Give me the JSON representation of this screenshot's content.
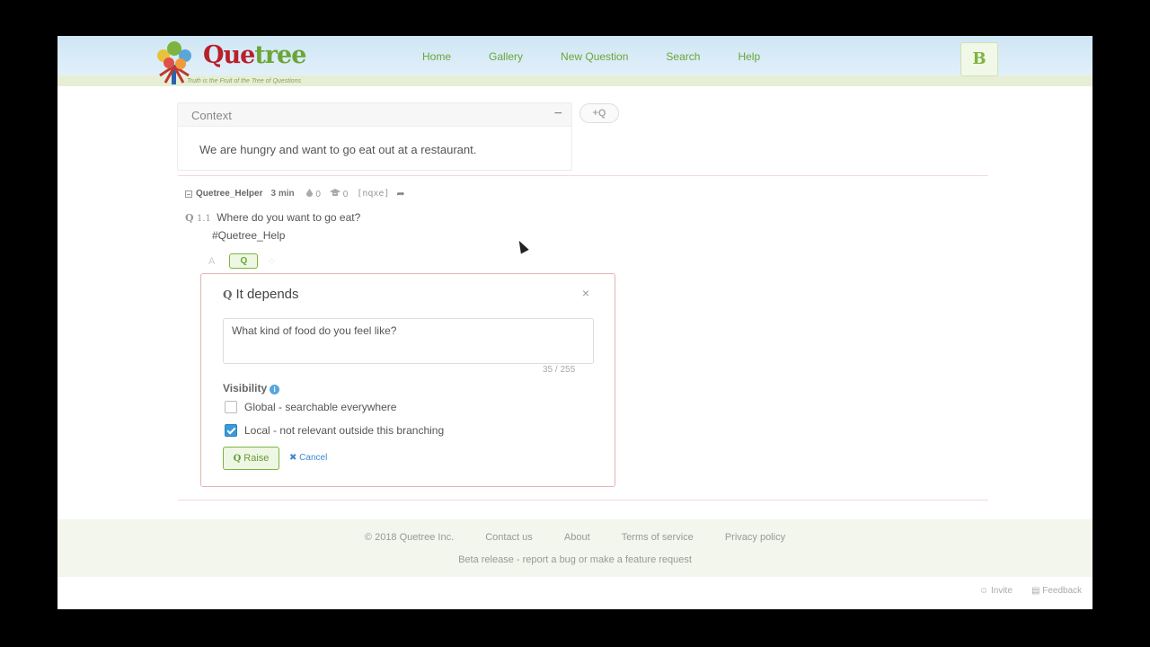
{
  "header": {
    "logo_brand_q": "Que",
    "logo_brand_t": "tree",
    "tagline": "Truth is the Fruit of the Tree of Questions",
    "nav": [
      "Home",
      "Gallery",
      "New Question",
      "Search",
      "Help"
    ],
    "avatar_initial": "B"
  },
  "context": {
    "title": "Context",
    "collapse": "−",
    "text": "We are hungry and want to go eat out at a restaurant.",
    "add_question": "+Q"
  },
  "thread": {
    "user": "Quetree_Helper",
    "time": "3 min",
    "likes": "0",
    "answers": "0",
    "code": "[nqxe]",
    "question_number": "1.1",
    "question_text": "Where do you want to go eat?",
    "tag": "#Quetree_Help",
    "action_answer": "A",
    "action_raise": "Q",
    "action_comment": "◌"
  },
  "dialog": {
    "title": "It depends",
    "close": "×",
    "input_value": "What kind of food do you feel like?",
    "char_count": "35 / 255",
    "visibility_label": "Visibility",
    "info": "i",
    "options": [
      {
        "label": "Global - searchable everywhere",
        "checked": false
      },
      {
        "label": "Local - not relevant outside this branching",
        "checked": true
      }
    ],
    "raise_label": "Raise",
    "cancel_label": "Cancel"
  },
  "footer": {
    "copyright": "© 2018 Quetree Inc.",
    "contact": "Contact us",
    "about": "About",
    "terms": "Terms of service",
    "privacy": "Privacy policy",
    "beta": "Beta release - report a bug or make a feature request",
    "invite": "Invite",
    "feedback": "Feedback"
  },
  "colors": {
    "brand_green": "#6aa637",
    "brand_red": "#b8202b",
    "link_blue": "#3a8ad0",
    "checkbox_blue": "#3a9ad9"
  }
}
